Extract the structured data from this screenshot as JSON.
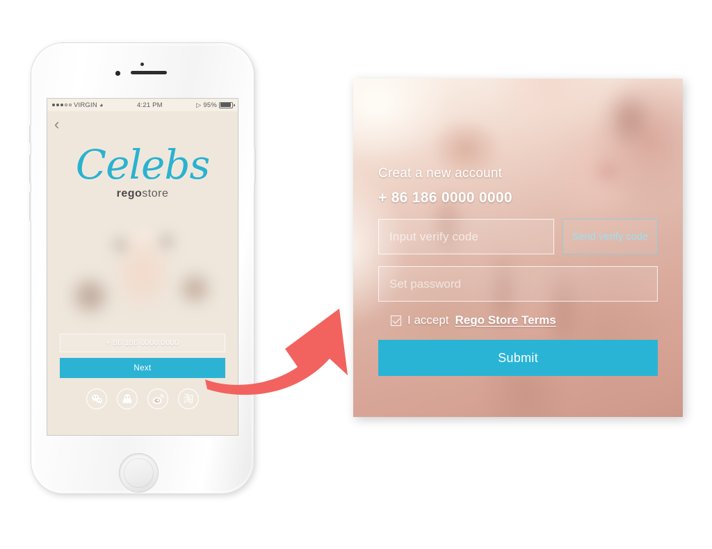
{
  "page": {
    "background": "#ffffff",
    "accent_teal": "#29b4d6",
    "arrow_color": "#f2635f"
  },
  "phone": {
    "device_name": "white-iphone",
    "status_bar": {
      "carrier": "VIRGIN",
      "wifi_icon": "wifi-icon",
      "time": "4:21 PM",
      "bluetooth_icon": "bluetooth-icon",
      "battery_percent": "95%",
      "battery_icon": "battery-icon",
      "signal_dots_filled": 3,
      "signal_dots_total": 5
    },
    "nav": {
      "back_icon": "chevron-left-icon"
    },
    "brand": {
      "wordmark": "Celebs",
      "sub_bold": "rego",
      "sub_light": "store",
      "wordmark_color": "#2ab2cf"
    },
    "form": {
      "phone_value": "+ 86 186 0000 0000",
      "next_label": "Next"
    },
    "socials": [
      {
        "name": "wechat",
        "icon": "wechat-icon"
      },
      {
        "name": "qq",
        "icon": "qq-icon"
      },
      {
        "name": "weibo",
        "icon": "weibo-icon"
      },
      {
        "name": "taobao",
        "icon": "taobao-icon",
        "glyph": "淘"
      }
    ]
  },
  "arrow": {
    "icon": "curved-arrow-icon",
    "direction": "up-right",
    "color": "#f2635f"
  },
  "signup": {
    "title": "Creat a new account",
    "phone_number": "+ 86 186 0000 0000",
    "verify_code": {
      "placeholder": "Input verify code",
      "value": ""
    },
    "send_code_label": "Send verify code",
    "password": {
      "placeholder": "Set password",
      "value": ""
    },
    "terms": {
      "checked": true,
      "prefix": "I accept",
      "link_label": "Rego Store Terms"
    },
    "submit_label": "Submit"
  }
}
